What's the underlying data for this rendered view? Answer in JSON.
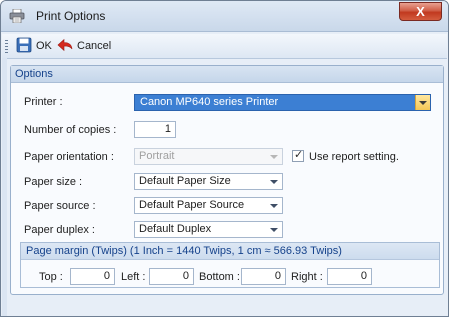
{
  "window": {
    "title": "Print Options",
    "close_label": "X"
  },
  "toolbar": {
    "ok_label": "OK",
    "cancel_label": "Cancel"
  },
  "options": {
    "group_title": "Options",
    "printer_label": "Printer :",
    "printer_value": "Canon MP640 series Printer",
    "copies_label": "Number of copies :",
    "copies_value": "1",
    "orientation_label": "Paper orientation :",
    "orientation_value": "Portrait",
    "use_report_setting_label": "Use report setting.",
    "use_report_setting_checked": true,
    "size_label": "Paper size :",
    "size_value": "Default Paper Size",
    "source_label": "Paper source :",
    "source_value": "Default Paper Source",
    "duplex_label": "Paper duplex :",
    "duplex_value": "Default Duplex"
  },
  "margin": {
    "header": "Page margin (Twips) (1 Inch = 1440 Twips, 1 cm ≈ 566.93 Twips)",
    "top_label": "Top :",
    "top_value": "0",
    "left_label": "Left :",
    "left_value": "0",
    "bottom_label": "Bottom :",
    "bottom_value": "0",
    "right_label": "Right :",
    "right_value": "0"
  },
  "icons": [
    "printer-icon",
    "save-icon",
    "back-arrow-icon",
    "close-icon"
  ],
  "colors": {
    "accent": "#3c7fd3",
    "close": "#c1391f",
    "header_text": "#15428b"
  }
}
